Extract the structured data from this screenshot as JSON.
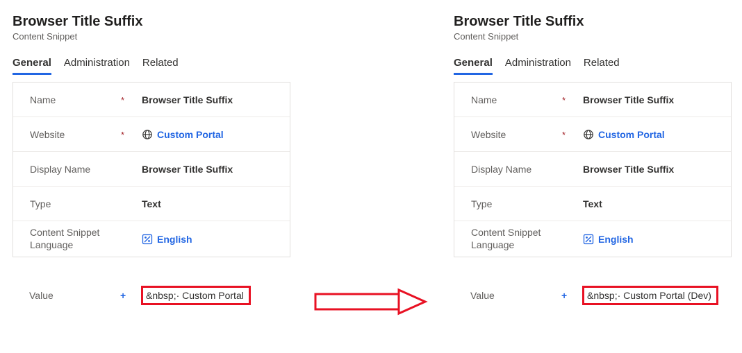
{
  "left": {
    "title": "Browser Title Suffix",
    "subtitle": "Content Snippet",
    "tabs": {
      "general": "General",
      "administration": "Administration",
      "related": "Related"
    },
    "labels": {
      "name": "Name",
      "website": "Website",
      "display_name": "Display Name",
      "type": "Type",
      "lang": "Content Snippet Language",
      "value": "Value"
    },
    "values": {
      "name": "Browser Title Suffix",
      "website": "Custom Portal",
      "display_name": "Browser Title Suffix",
      "type": "Text",
      "lang": "English",
      "value": "&nbsp;· Custom Portal"
    }
  },
  "right": {
    "title": "Browser Title Suffix",
    "subtitle": "Content Snippet",
    "tabs": {
      "general": "General",
      "administration": "Administration",
      "related": "Related"
    },
    "labels": {
      "name": "Name",
      "website": "Website",
      "display_name": "Display Name",
      "type": "Type",
      "lang": "Content Snippet Language",
      "value": "Value"
    },
    "values": {
      "name": "Browser Title Suffix",
      "website": "Custom Portal",
      "display_name": "Browser Title Suffix",
      "type": "Text",
      "lang": "English",
      "value": "&nbsp;· Custom Portal (Dev)"
    }
  },
  "req_marker": "*",
  "rec_marker": "+"
}
